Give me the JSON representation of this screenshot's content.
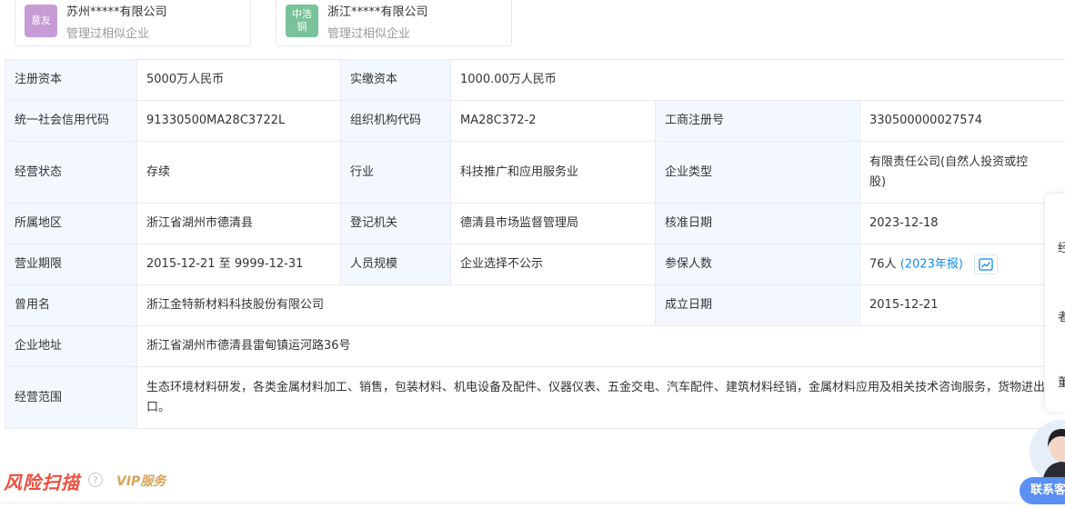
{
  "similar_companies": [
    {
      "logo_text": "意友",
      "name": "苏州*****有限公司",
      "sub": "管理过相似企业",
      "logo_color": "#c79bd6"
    },
    {
      "logo_text": "中浩\n铜",
      "name": "浙江*****有限公司",
      "sub": "管理过相似企业",
      "logo_color": "#79c39a"
    }
  ],
  "info": {
    "reg_capital_label": "注册资本",
    "reg_capital": "5000万人民币",
    "paid_capital_label": "实缴资本",
    "paid_capital": "1000.00万人民币",
    "credit_code_label": "统一社会信用代码",
    "credit_code": "91330500MA28C3722L",
    "org_code_label": "组织机构代码",
    "org_code": "MA28C372-2",
    "biz_reg_no_label": "工商注册号",
    "biz_reg_no": "330500000027574",
    "status_label": "经营状态",
    "status": "存续",
    "industry_label": "行业",
    "industry": "科技推广和应用服务业",
    "company_type_label": "企业类型",
    "company_type": "有限责任公司(自然人投资或控股)",
    "region_label": "所属地区",
    "region": "浙江省湖州市德清县",
    "reg_authority_label": "登记机关",
    "reg_authority": "德清县市场监督管理局",
    "approval_date_label": "核准日期",
    "approval_date": "2023-12-18",
    "term_label": "营业期限",
    "term": "2015-12-21 至 9999-12-31",
    "staff_size_label": "人员规模",
    "staff_size": "企业选择不公示",
    "insured_label": "参保人数",
    "insured": "76人",
    "insured_report": "(2023年报)",
    "former_name_label": "曾用名",
    "former_name": "浙江金特新材料科技股份有限公司",
    "founded_label": "成立日期",
    "founded": "2015-12-21",
    "address_label": "企业地址",
    "address": "浙江省湖州市德清县雷甸镇运河路36号",
    "scope_label": "经营范围",
    "scope": "生态环境材料研发，各类金属材料加工、销售，包装材料、机电设备及配件、仪器仪表、五金交电、汽车配件、建筑材料经销，金属材料应用及相关技术咨询服务，货物进出口。"
  },
  "risk": {
    "title": "风险扫描",
    "help": "?",
    "vip": "VIP服务"
  },
  "contact": {
    "label": "联系客服"
  },
  "side": {
    "chars": [
      "经",
      "者",
      "董"
    ]
  },
  "colors": {
    "accent": "#128bed",
    "label_bg": "#f2f8fe",
    "risk": "#f14d3e",
    "vip": "#d9a35a"
  }
}
